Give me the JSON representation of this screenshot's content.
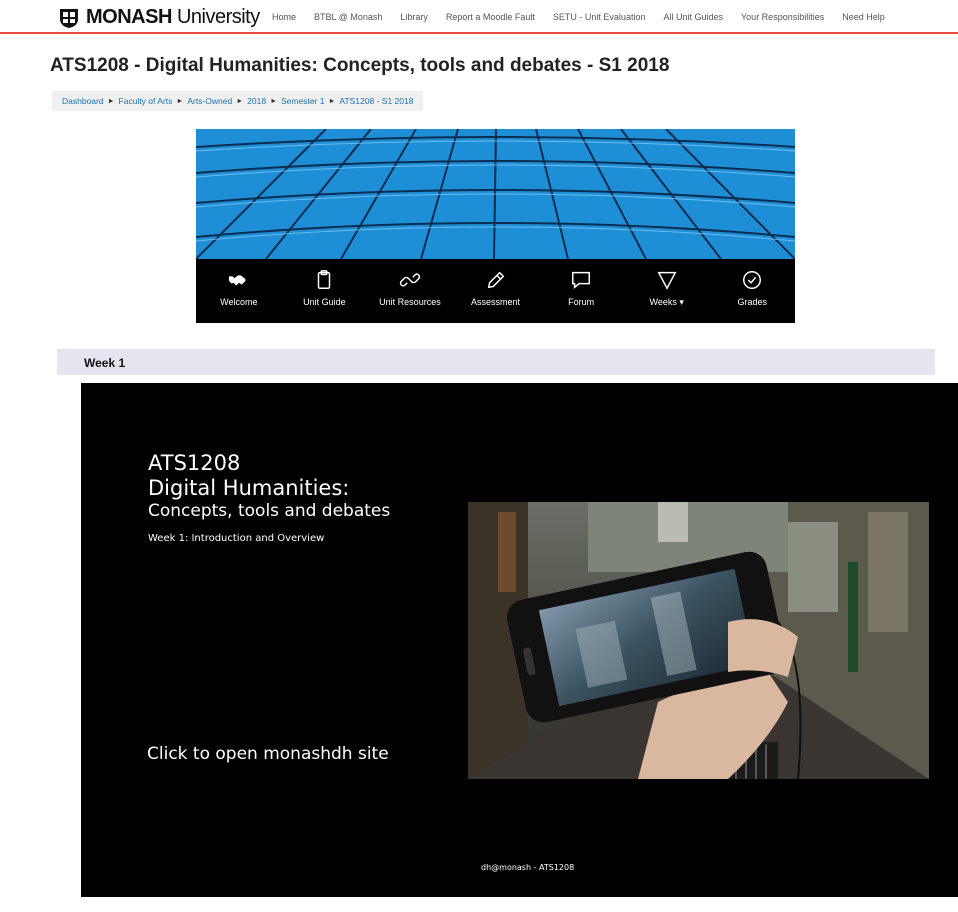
{
  "header": {
    "brand_bold": "MONASH",
    "brand_rest": " University",
    "nav": [
      "Home",
      "BTBL @ Monash",
      "Library",
      "Report a Moodle Fault",
      "SETU - Unit Evaluation",
      "All Unit Guides",
      "Your Responsibilities",
      "Need Help"
    ]
  },
  "page": {
    "title": "ATS1208 - Digital Humanities: Concepts, tools and debates - S1 2018"
  },
  "breadcrumb": [
    "Dashboard",
    "Faculty of Arts",
    "Arts-Owned",
    "2018",
    "Semester 1",
    "ATS1208 - S1 2018"
  ],
  "unit_menu": [
    {
      "label": "Welcome",
      "icon": "handshake-icon"
    },
    {
      "label": "Unit Guide",
      "icon": "clipboard-icon"
    },
    {
      "label": "Unit Resources",
      "icon": "link-icon"
    },
    {
      "label": "Assessment",
      "icon": "pencil-icon"
    },
    {
      "label": "Forum",
      "icon": "speech-bubble-icon"
    },
    {
      "label": "Weeks ▾",
      "icon": "triangle-down-icon"
    },
    {
      "label": "Grades",
      "icon": "check-circle-icon"
    }
  ],
  "section": {
    "title": "Week 1"
  },
  "slide": {
    "line1": "ATS1208",
    "line2": "Digital Humanities:",
    "subtitle": "Concepts, tools and debates",
    "week": "Week 1: Introduction and Overview",
    "cta": "Click to open monashdh site",
    "footer": "dh@monash - ATS1208"
  },
  "colors": {
    "accent_red": "#e74c3c",
    "link_blue": "#1d73b0",
    "banner_blue": "#1e8fd6",
    "week_bar": "#e5e4ef"
  }
}
